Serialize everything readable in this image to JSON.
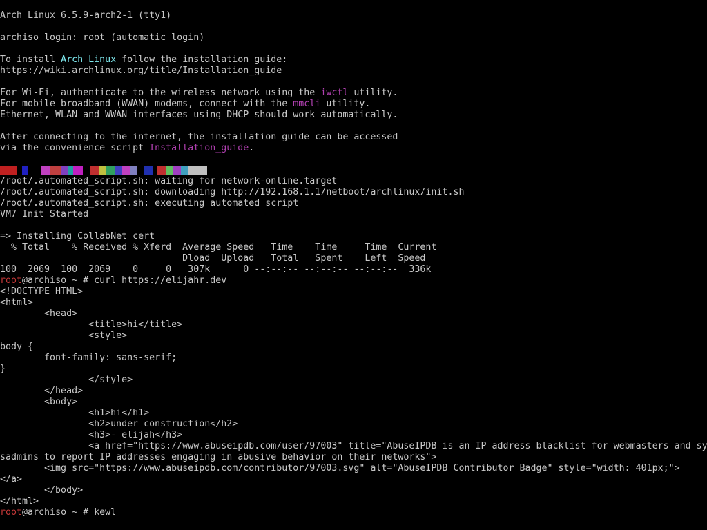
{
  "window": {
    "title": "Arch Linux 6.5.9-arch2-1 (tty1)"
  },
  "colors": {
    "fg": "#c8c8c8",
    "cyan": "#7ee8ee",
    "magenta": "#b040b0",
    "red": "#c43838",
    "bg": "#000000"
  },
  "lines": [
    [
      {
        "t": "Arch Linux 6.5.9-arch2-1 (tty1)"
      }
    ],
    [
      {
        "t": ""
      }
    ],
    [
      {
        "t": "archiso login: root (automatic login)"
      }
    ],
    [
      {
        "t": ""
      }
    ],
    [
      {
        "t": "To install "
      },
      {
        "t": "Arch Linux",
        "c": "cyan"
      },
      {
        "t": " follow the installation guide:"
      }
    ],
    [
      {
        "t": "https://wiki.archlinux.org/title/Installation_guide"
      }
    ],
    [
      {
        "t": ""
      }
    ],
    [
      {
        "t": "For Wi-Fi, authenticate to the wireless network using the "
      },
      {
        "t": "iwctl",
        "c": "magenta"
      },
      {
        "t": " utility."
      }
    ],
    [
      {
        "t": "For mobile broadband (WWAN) modems, connect with the "
      },
      {
        "t": "mmcli",
        "c": "magenta"
      },
      {
        "t": " utility."
      }
    ],
    [
      {
        "t": "Ethernet, WLAN and WWAN interfaces using DHCP should work automatically."
      }
    ],
    [
      {
        "t": ""
      }
    ],
    [
      {
        "t": "After connecting to the internet, the installation guide can be accessed"
      }
    ],
    [
      {
        "t": "via the convenience script "
      },
      {
        "t": "Installation_guide",
        "c": "magenta"
      },
      {
        "t": "."
      }
    ],
    [
      {
        "t": ""
      }
    ],
    [
      {
        "glitch": true
      }
    ],
    [
      {
        "t": "/root/.automated_script.sh: waiting for network-online.target"
      }
    ],
    [
      {
        "t": "/root/.automated_script.sh: downloading http://192.168.1.1/netboot/archlinux/init.sh"
      }
    ],
    [
      {
        "t": "/root/.automated_script.sh: executing automated script"
      }
    ],
    [
      {
        "t": "VM7 Init Started"
      }
    ],
    [
      {
        "t": ""
      }
    ],
    [
      {
        "t": "=> Installing CollabNet cert"
      }
    ],
    [
      {
        "t": "  % Total    % Received % Xferd  Average Speed   Time    Time     Time  Current"
      }
    ],
    [
      {
        "t": "                                 Dload  Upload   Total   Spent    Left  Speed"
      }
    ],
    [
      {
        "t": "100  2069  100  2069    0     0   307k      0 --:--:-- --:--:-- --:--:--  336k"
      }
    ],
    [
      {
        "t": "root",
        "c": "red"
      },
      {
        "t": "@archiso ~ # curl https://elijahr.dev"
      }
    ],
    [
      {
        "t": "<!DOCTYPE HTML>"
      }
    ],
    [
      {
        "t": "<html>"
      }
    ],
    [
      {
        "t": "        <head>"
      }
    ],
    [
      {
        "t": "                <title>hi</title>"
      }
    ],
    [
      {
        "t": "                <style>"
      }
    ],
    [
      {
        "t": "body {"
      }
    ],
    [
      {
        "t": "        font-family: sans-serif;"
      }
    ],
    [
      {
        "t": "}"
      }
    ],
    [
      {
        "t": "                </style>"
      }
    ],
    [
      {
        "t": "        </head>"
      }
    ],
    [
      {
        "t": "        <body>"
      }
    ],
    [
      {
        "t": "                <h1>hi</h1>"
      }
    ],
    [
      {
        "t": "                <h2>under construction</h2>"
      }
    ],
    [
      {
        "t": "                <h3>- elijah</h3>"
      }
    ],
    [
      {
        "t": "                <a href=\"https://www.abuseipdb.com/user/97003\" title=\"AbuseIPDB is an IP address blacklist for webmasters and sy"
      }
    ],
    [
      {
        "t": "sadmins to report IP addresses engaging in abusive behavior on their networks\">"
      }
    ],
    [
      {
        "t": "        <img src=\"https://www.abuseipdb.com/contributor/97003.svg\" alt=\"AbuseIPDB Contributor Badge\" style=\"width: 401px;\">"
      }
    ],
    [
      {
        "t": "</a>"
      }
    ],
    [
      {
        "t": "        </body>"
      }
    ],
    [
      {
        "t": "</html>"
      }
    ],
    [
      {
        "t": "root",
        "c": "red"
      },
      {
        "t": "@archiso ~ # kewl"
      }
    ]
  ],
  "glitch_colors": [
    "#c02020",
    "#000000",
    "#2020c0",
    "#000000",
    "#c040c0",
    "#c04040",
    "#8040c0",
    "#20a0a0",
    "#c020c0",
    "#000000",
    "#c03030",
    "#c0c040",
    "#30a060",
    "#4040c0",
    "#c040c0",
    "#8080c0",
    "#000000",
    "#2030b0",
    "#000000",
    "#c03030",
    "#60c060",
    "#a040c0",
    "#40a0c0",
    "#c0c0c0"
  ]
}
